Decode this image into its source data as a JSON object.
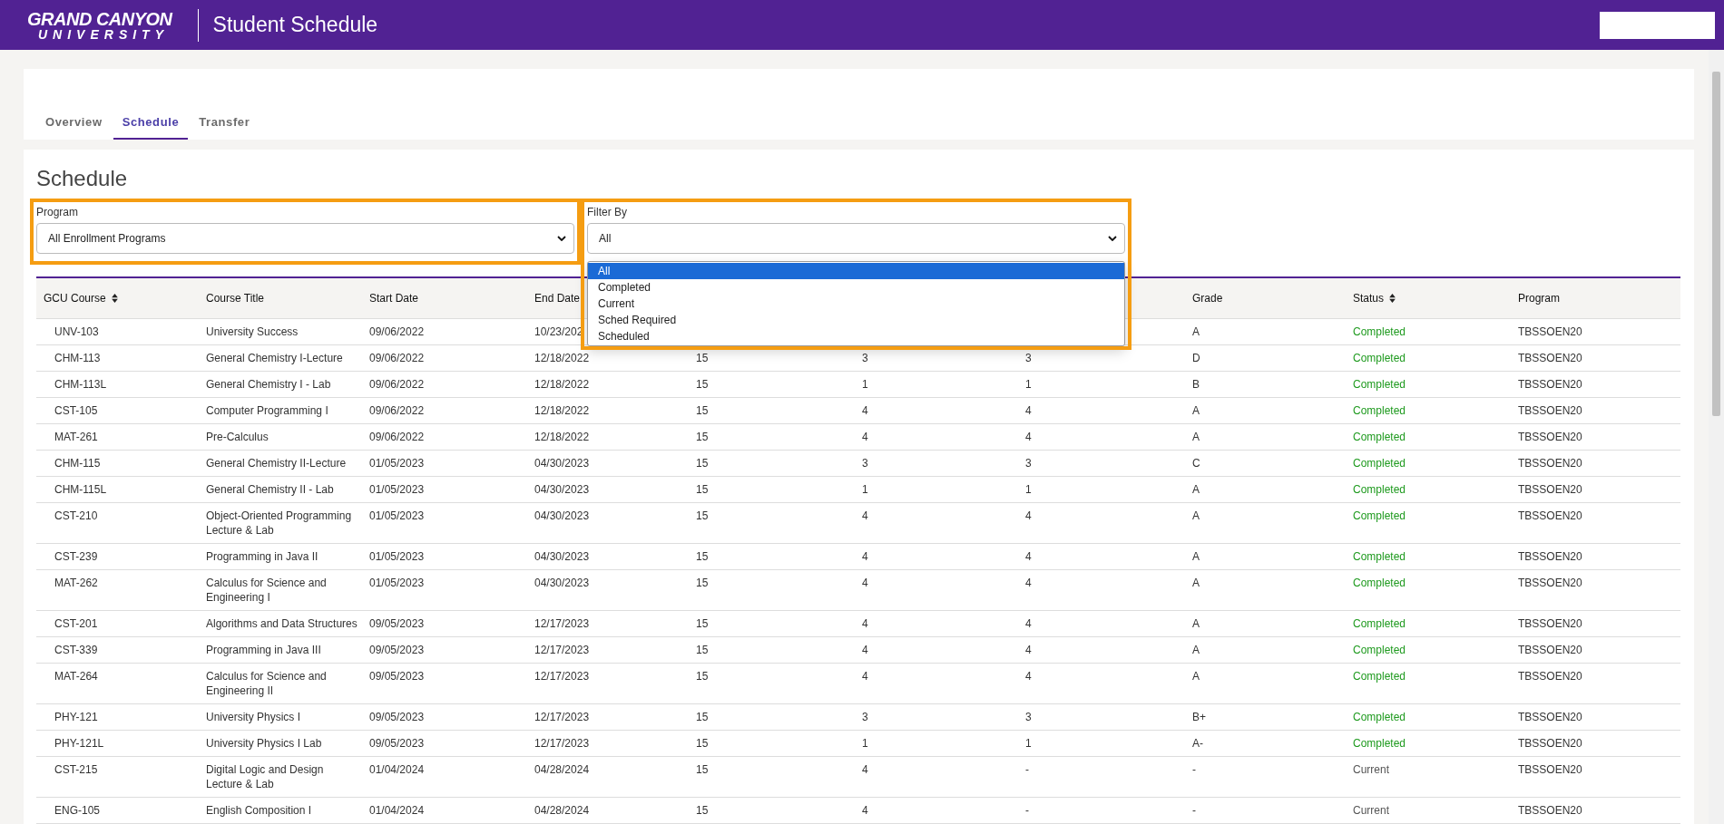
{
  "header": {
    "logo_line_1": "GRAND CANYON",
    "logo_line_2": "UNIVERSITY",
    "title": "Student Schedule"
  },
  "tabs": [
    {
      "label": "Overview",
      "selected": false
    },
    {
      "label": "Schedule",
      "selected": true
    },
    {
      "label": "Transfer",
      "selected": false
    }
  ],
  "page_title": "Schedule",
  "filters": [
    {
      "label": "Program",
      "value": "All Enrollment Programs",
      "highlighted": true
    },
    {
      "label": "Filter By",
      "value": "All",
      "highlighted": true,
      "options": [
        {
          "label": "All",
          "selected": true
        },
        {
          "label": "Completed",
          "selected": false
        },
        {
          "label": "Current",
          "selected": false
        },
        {
          "label": "Sched Required",
          "selected": false
        },
        {
          "label": "Scheduled",
          "selected": false
        }
      ]
    }
  ],
  "table": {
    "columns": [
      {
        "label": "GCU Course",
        "sortable": true
      },
      {
        "label": "Course Title",
        "sortable": false
      },
      {
        "label": "Start Date",
        "sortable": false
      },
      {
        "label": "End Date",
        "sortable": false
      },
      {},
      {},
      {},
      {
        "label": "Grade",
        "sortable": false
      },
      {
        "label": "Status",
        "sortable": true
      },
      {
        "label": "Program",
        "sortable": false
      }
    ],
    "rows": [
      {
        "cells": [
          "UNV-103",
          "University Success",
          "09/06/2022",
          "10/23/202",
          "",
          "",
          "",
          "A"
        ],
        "status": {
          "text": "Completed",
          "color": "#1e9a1e"
        },
        "program": "TBSSOEN20"
      },
      {
        "cells": [
          "CHM-113",
          "General Chemistry I-Lecture",
          "09/06/2022",
          "12/18/2022",
          "15",
          "3",
          "3",
          "D"
        ],
        "status": {
          "text": "Completed",
          "color": "#1e9a1e"
        },
        "program": "TBSSOEN20"
      },
      {
        "cells": [
          "CHM-113L",
          "General Chemistry I - Lab",
          "09/06/2022",
          "12/18/2022",
          "15",
          "1",
          "1",
          "B"
        ],
        "status": {
          "text": "Completed",
          "color": "#1e9a1e"
        },
        "program": "TBSSOEN20"
      },
      {
        "cells": [
          "CST-105",
          "Computer Programming I",
          "09/06/2022",
          "12/18/2022",
          "15",
          "4",
          "4",
          "A"
        ],
        "status": {
          "text": "Completed",
          "color": "#1e9a1e"
        },
        "program": "TBSSOEN20"
      },
      {
        "cells": [
          "MAT-261",
          "Pre-Calculus",
          "09/06/2022",
          "12/18/2022",
          "15",
          "4",
          "4",
          "A"
        ],
        "status": {
          "text": "Completed",
          "color": "#1e9a1e"
        },
        "program": "TBSSOEN20"
      },
      {
        "cells": [
          "CHM-115",
          "General Chemistry II-Lecture",
          "01/05/2023",
          "04/30/2023",
          "15",
          "3",
          "3",
          "C"
        ],
        "status": {
          "text": "Completed",
          "color": "#1e9a1e"
        },
        "program": "TBSSOEN20"
      },
      {
        "cells": [
          "CHM-115L",
          "General Chemistry II - Lab",
          "01/05/2023",
          "04/30/2023",
          "15",
          "1",
          "1",
          "A"
        ],
        "status": {
          "text": "Completed",
          "color": "#1e9a1e"
        },
        "program": "TBSSOEN20"
      },
      {
        "cells": [
          "CST-210",
          "Object-Oriented Programming Lecture & Lab",
          "01/05/2023",
          "04/30/2023",
          "15",
          "4",
          "4",
          "A"
        ],
        "status": {
          "text": "Completed",
          "color": "#1e9a1e"
        },
        "program": "TBSSOEN20"
      },
      {
        "cells": [
          "CST-239",
          "Programming in Java II",
          "01/05/2023",
          "04/30/2023",
          "15",
          "4",
          "4",
          "A"
        ],
        "status": {
          "text": "Completed",
          "color": "#1e9a1e"
        },
        "program": "TBSSOEN20"
      },
      {
        "cells": [
          "MAT-262",
          "Calculus for Science and Engineering I",
          "01/05/2023",
          "04/30/2023",
          "15",
          "4",
          "4",
          "A"
        ],
        "status": {
          "text": "Completed",
          "color": "#1e9a1e"
        },
        "program": "TBSSOEN20"
      },
      {
        "cells": [
          "CST-201",
          "Algorithms and Data Structures",
          "09/05/2023",
          "12/17/2023",
          "15",
          "4",
          "4",
          "A"
        ],
        "status": {
          "text": "Completed",
          "color": "#1e9a1e"
        },
        "program": "TBSSOEN20"
      },
      {
        "cells": [
          "CST-339",
          "Programming in Java III",
          "09/05/2023",
          "12/17/2023",
          "15",
          "4",
          "4",
          "A"
        ],
        "status": {
          "text": "Completed",
          "color": "#1e9a1e"
        },
        "program": "TBSSOEN20"
      },
      {
        "cells": [
          "MAT-264",
          "Calculus for Science and Engineering II",
          "09/05/2023",
          "12/17/2023",
          "15",
          "4",
          "4",
          "A"
        ],
        "status": {
          "text": "Completed",
          "color": "#1e9a1e"
        },
        "program": "TBSSOEN20"
      },
      {
        "cells": [
          "PHY-121",
          "University Physics I",
          "09/05/2023",
          "12/17/2023",
          "15",
          "3",
          "3",
          "B+"
        ],
        "status": {
          "text": "Completed",
          "color": "#1e9a1e"
        },
        "program": "TBSSOEN20"
      },
      {
        "cells": [
          "PHY-121L",
          "University Physics I Lab",
          "09/05/2023",
          "12/17/2023",
          "15",
          "1",
          "1",
          "A-"
        ],
        "status": {
          "text": "Completed",
          "color": "#1e9a1e"
        },
        "program": "TBSSOEN20"
      },
      {
        "cells": [
          "CST-215",
          "Digital Logic and Design Lecture & Lab",
          "01/04/2024",
          "04/28/2024",
          "15",
          "4",
          "-",
          "-"
        ],
        "status": {
          "text": "Current",
          "color": "#555555"
        },
        "program": "TBSSOEN20"
      },
      {
        "cells": [
          "ENG-105",
          "English Composition I",
          "01/04/2024",
          "04/28/2024",
          "15",
          "4",
          "-",
          "-"
        ],
        "status": {
          "text": "Current",
          "color": "#555555"
        },
        "program": "TBSSOEN20"
      }
    ]
  }
}
